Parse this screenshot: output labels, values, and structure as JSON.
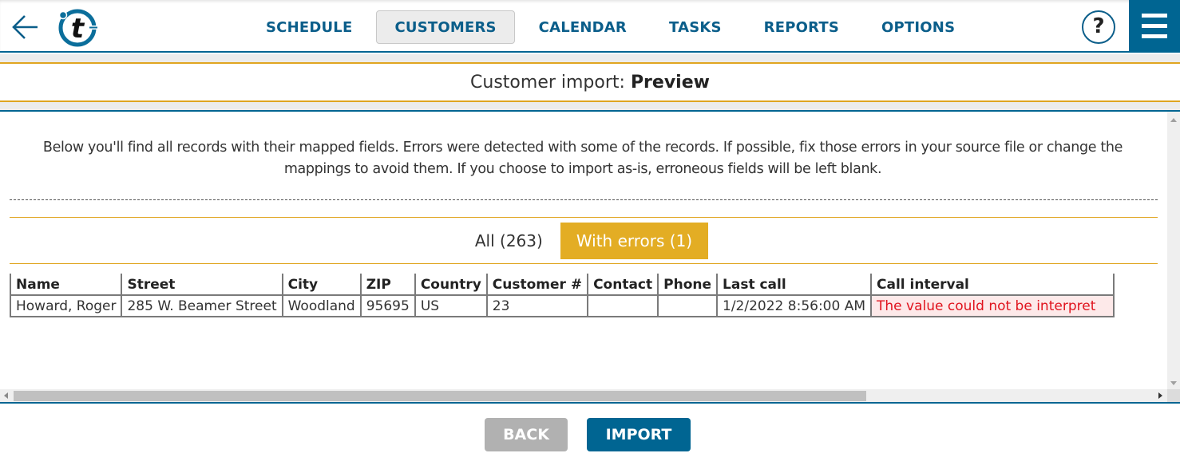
{
  "header": {
    "back_icon": "arrow-left-icon",
    "logo_letter": "t",
    "nav": [
      {
        "label": "SCHEDULE",
        "active": false
      },
      {
        "label": "CUSTOMERS",
        "active": true
      },
      {
        "label": "CALENDAR",
        "active": false
      },
      {
        "label": "TASKS",
        "active": false
      },
      {
        "label": "REPORTS",
        "active": false
      },
      {
        "label": "OPTIONS",
        "active": false
      }
    ],
    "help_label": "?",
    "menu_icon": "hamburger-icon"
  },
  "page": {
    "title_prefix": "Customer import: ",
    "title_bold": "Preview"
  },
  "intro_text": "Below you'll find all records with their mapped fields. Errors were detected with some of the records. If possible, fix those errors in your source file or change the mappings to avoid them. If you choose to import as-is, erroneous fields will be left blank.",
  "filters": [
    {
      "label": "All (263)",
      "active": false
    },
    {
      "label": "With errors (1)",
      "active": true
    }
  ],
  "table": {
    "columns": [
      "Name",
      "Street",
      "City",
      "ZIP",
      "Country",
      "Customer #",
      "Contact",
      "Phone",
      "Last call",
      "Call interval"
    ],
    "rows": [
      {
        "cells": [
          "Howard, Roger",
          "285 W. Beamer Street",
          "Woodland",
          "95695",
          "US",
          "23",
          "",
          "",
          "1/2/2022 8:56:00 AM",
          "The value could not be interpret"
        ],
        "error_columns": [
          9
        ]
      }
    ]
  },
  "colors": {
    "primary": "#006592",
    "accent": "#e3ad24",
    "error_text": "#e0141e",
    "error_bg": "#fde9e9"
  },
  "footer": {
    "back_label": "BACK",
    "import_label": "IMPORT"
  }
}
